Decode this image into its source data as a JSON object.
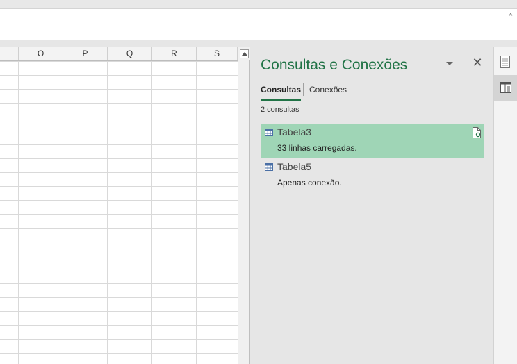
{
  "ribbon": {
    "collapse_icon": "chevron-up-icon",
    "collapse_glyph": "^"
  },
  "sheet": {
    "columns": [
      "O",
      "P",
      "Q",
      "R",
      "S"
    ]
  },
  "pane": {
    "title": "Consultas e Conexões",
    "close_glyph": "✕",
    "tabs": [
      {
        "label": "Consultas",
        "active": true
      },
      {
        "label": "Conexões",
        "active": false
      }
    ],
    "count_label": "2 consultas",
    "queries": [
      {
        "name": "Tabela3",
        "status": "33 linhas carregadas.",
        "selected": true
      },
      {
        "name": "Tabela5",
        "status": "Apenas conexão.",
        "selected": false
      }
    ]
  },
  "colors": {
    "accent": "#217346",
    "selected_row": "#9fd5b6",
    "pane_bg": "#e6e6e6"
  }
}
